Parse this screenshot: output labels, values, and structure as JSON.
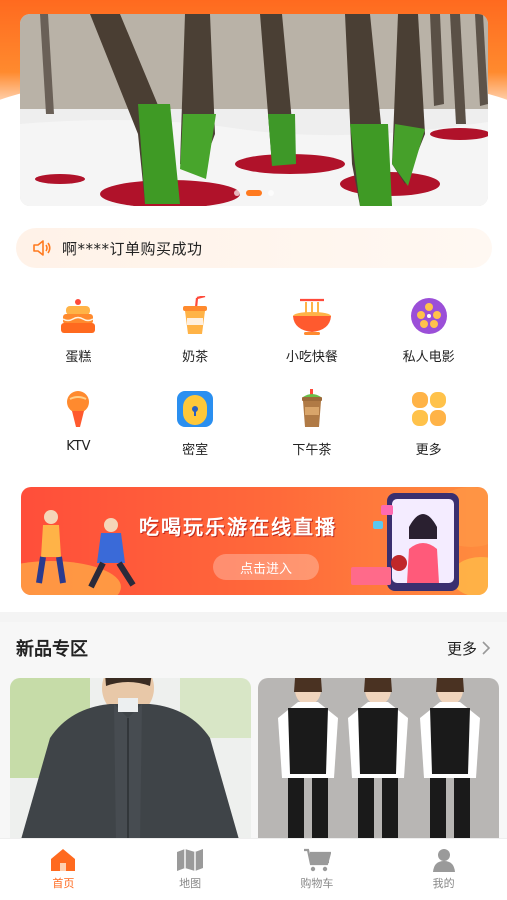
{
  "notice": {
    "text": "啊****订单购买成功",
    "icon": "speaker-icon"
  },
  "categories": [
    {
      "label": "蛋糕",
      "icon": "cake-icon"
    },
    {
      "label": "奶茶",
      "icon": "milk-tea-icon"
    },
    {
      "label": "小吃快餐",
      "icon": "noodle-bowl-icon"
    },
    {
      "label": "私人电影",
      "icon": "film-reel-icon"
    },
    {
      "label": "KTV",
      "icon": "microphone-icon"
    },
    {
      "label": "密室",
      "icon": "lock-door-icon"
    },
    {
      "label": "下午茶",
      "icon": "iced-drink-icon"
    },
    {
      "label": "更多",
      "icon": "more-grid-icon"
    }
  ],
  "promo": {
    "title": "吃喝玩乐游在线直播",
    "button": "点击进入"
  },
  "new_section": {
    "title": "新品专区",
    "more": "更多"
  },
  "tabbar": [
    {
      "label": "首页",
      "icon": "home-icon",
      "active": true
    },
    {
      "label": "地图",
      "icon": "map-icon",
      "active": false
    },
    {
      "label": "购物车",
      "icon": "cart-icon",
      "active": false
    },
    {
      "label": "我的",
      "icon": "user-icon",
      "active": false
    }
  ],
  "colors": {
    "accent": "#ff6a1f",
    "promo": "#ff4e3a"
  }
}
